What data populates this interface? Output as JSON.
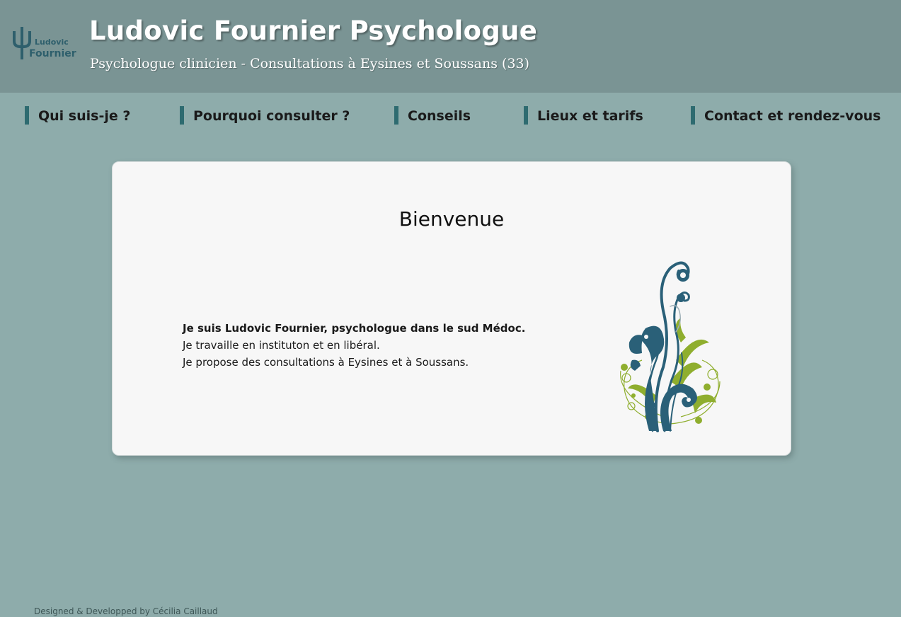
{
  "header": {
    "logo_line1": "Ludovic",
    "logo_line2": "Fournier",
    "title": "Ludovic Fournier Psychologue",
    "subtitle": "Psychologue clinicien - Consultations à Eysines et Soussans (33)"
  },
  "nav": {
    "items": [
      {
        "label": "Qui suis-je ?"
      },
      {
        "label": "Pourquoi consulter ?"
      },
      {
        "label": "Conseils"
      },
      {
        "label": "Lieux et tarifs"
      },
      {
        "label": "Contact et rendez-vous"
      }
    ]
  },
  "main": {
    "title": "Bienvenue",
    "intro_bold": "Je suis Ludovic Fournier, psychologue dans le sud Médoc.",
    "intro_line2": "Je travaille en instituton et en libéral.",
    "intro_line3": "Je propose des consultations à Eysines et à Soussans."
  },
  "footer": {
    "credit": "Designed & Developped by Cécilia Caillaud"
  },
  "colors": {
    "background": "#8eacab",
    "header": "#7a9494",
    "nav_accent": "#2e6b70",
    "ornament_blue": "#2a6078",
    "ornament_green": "#8fae2e"
  },
  "icons": {
    "logo": "psi-logo-icon",
    "ornament": "floral-swirl-ornament"
  }
}
